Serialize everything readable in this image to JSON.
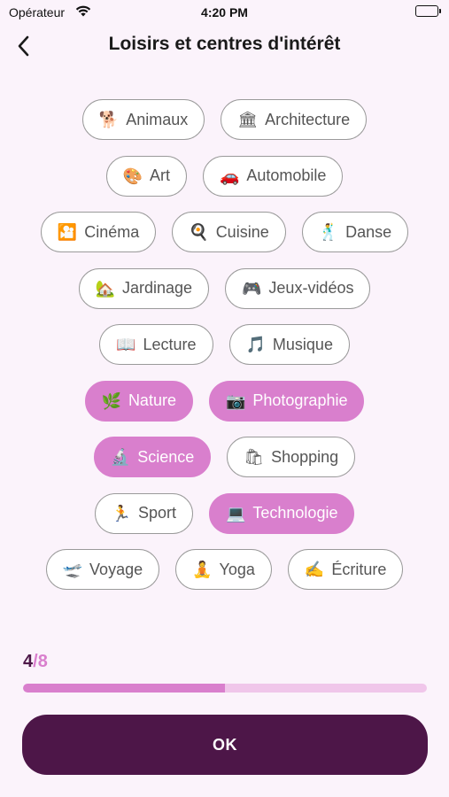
{
  "status": {
    "carrier": "Opérateur",
    "time": "4:20 PM"
  },
  "header": {
    "title": "Loisirs et centres d'intérêt"
  },
  "chip_rows": [
    [
      {
        "emoji": "🐕",
        "label": "Animaux",
        "selected": false,
        "icon": "dog-icon"
      },
      {
        "emoji": "🏛",
        "label": "Architecture",
        "selected": false,
        "icon": "building-icon"
      }
    ],
    [
      {
        "emoji": "🎨",
        "label": "Art",
        "selected": false,
        "icon": "palette-icon"
      },
      {
        "emoji": "🚗",
        "label": "Automobile",
        "selected": false,
        "icon": "car-icon"
      }
    ],
    [
      {
        "emoji": "🎦",
        "label": "Cinéma",
        "selected": false,
        "icon": "cinema-icon"
      },
      {
        "emoji": "🍳",
        "label": "Cuisine",
        "selected": false,
        "icon": "frying-pan-icon"
      },
      {
        "emoji": "🕺",
        "label": "Danse",
        "selected": false,
        "icon": "dancer-icon"
      }
    ],
    [
      {
        "emoji": "🏡",
        "label": "Jardinage",
        "selected": false,
        "icon": "house-garden-icon"
      },
      {
        "emoji": "🎮",
        "label": "Jeux-vidéos",
        "selected": false,
        "icon": "game-controller-icon"
      }
    ],
    [
      {
        "emoji": "📖",
        "label": "Lecture",
        "selected": false,
        "icon": "book-icon"
      },
      {
        "emoji": "🎵",
        "label": "Musique",
        "selected": false,
        "icon": "music-note-icon"
      }
    ],
    [
      {
        "emoji": "🌿",
        "label": "Nature",
        "selected": true,
        "icon": "leaf-icon"
      },
      {
        "emoji": "📷",
        "label": "Photographie",
        "selected": true,
        "icon": "camera-icon"
      }
    ],
    [
      {
        "emoji": "🔬",
        "label": "Science",
        "selected": true,
        "icon": "microscope-icon"
      },
      {
        "emoji": "🛍",
        "label": "Shopping",
        "selected": false,
        "icon": "shopping-bags-icon"
      }
    ],
    [
      {
        "emoji": "🏃",
        "label": "Sport",
        "selected": false,
        "icon": "runner-icon"
      },
      {
        "emoji": "💻",
        "label": "Technologie",
        "selected": true,
        "icon": "laptop-icon"
      }
    ],
    [
      {
        "emoji": "🛫",
        "label": "Voyage",
        "selected": false,
        "icon": "airplane-icon"
      },
      {
        "emoji": "🧘",
        "label": "Yoga",
        "selected": false,
        "icon": "yoga-icon"
      },
      {
        "emoji": "✍",
        "label": "Écriture",
        "selected": false,
        "icon": "writing-hand-icon"
      }
    ]
  ],
  "progress": {
    "current": "4",
    "separator": "/",
    "total": "8",
    "fraction": 0.5
  },
  "ok_button": {
    "label": "OK"
  },
  "colors": {
    "selected": "#d97fcd",
    "primary": "#4d1648",
    "background": "#fbf3fb"
  }
}
